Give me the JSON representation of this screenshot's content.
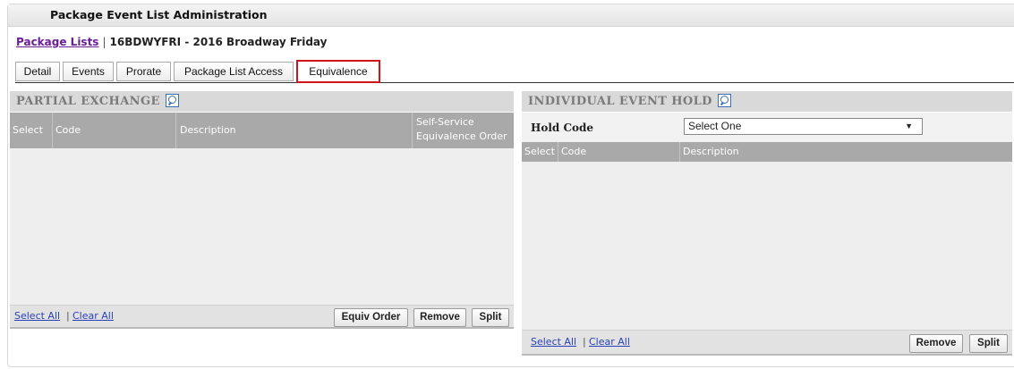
{
  "header": {
    "title": "Package Event List Administration"
  },
  "breadcrumb": {
    "link_label": "Package Lists",
    "separator": "|",
    "current": "16BDWYFRI - 2016 Broadway Friday"
  },
  "tabs": [
    {
      "label": "Detail",
      "active": false
    },
    {
      "label": "Events",
      "active": false
    },
    {
      "label": "Prorate",
      "active": false
    },
    {
      "label": "Package List Access",
      "active": false
    },
    {
      "label": "Equivalence",
      "active": true
    }
  ],
  "partial_exchange": {
    "title": "PARTIAL EXCHANGE",
    "search_icon": "magnifier-icon",
    "columns": {
      "select": "Select",
      "code": "Code",
      "description": "Description",
      "order_line1": "Self-Service",
      "order_line2": "Equivalence Order"
    },
    "footer": {
      "select_all": "Select All",
      "pipe": "|",
      "clear_all": "Clear All",
      "equiv_order": "Equiv Order",
      "remove": "Remove",
      "split": "Split"
    }
  },
  "individual_hold": {
    "title": "INDIVIDUAL EVENT HOLD",
    "search_icon": "magnifier-icon",
    "hold_code_label": "Hold Code",
    "hold_code_value": "Select One",
    "columns": {
      "select": "Select",
      "code": "Code",
      "description": "Description"
    },
    "footer": {
      "select_all": "Select All",
      "pipe": "|",
      "clear_all": "Clear All",
      "remove": "Remove",
      "split": "Split"
    }
  },
  "colors": {
    "active_tab_border": "#d0141d",
    "link": "#6a1e99",
    "footer_link": "#2a3fb8",
    "column_header": "#a9a9a9",
    "panel_header": "#d9d9d9"
  }
}
